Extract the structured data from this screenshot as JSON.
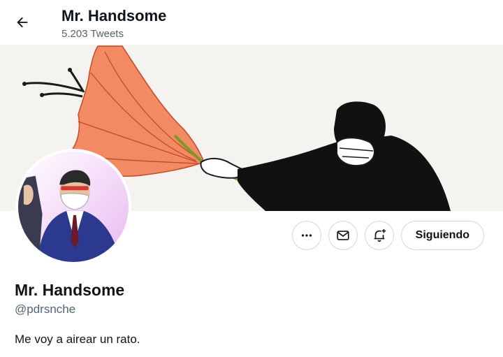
{
  "header": {
    "title": "Mr. Handsome",
    "tweet_count": "5.203 Tweets",
    "back_icon": "arrow-left-icon"
  },
  "banner": {
    "description_icon": "banner-image",
    "background_color": "#f4f3ef",
    "accent_color": "#f28b64"
  },
  "profile": {
    "avatar_icon": "avatar-image",
    "display_name": "Mr. Handsome",
    "handle": "@pdrsnche",
    "bio": "Me voy a airear un rato."
  },
  "actions": {
    "more_icon": "more-dots-icon",
    "message_icon": "envelope-icon",
    "notify_icon": "bell-plus-icon",
    "follow_label": "Siguiendo"
  },
  "colors": {
    "text_primary": "#0f1419",
    "text_secondary": "#536471",
    "border": "#cfd9de"
  }
}
